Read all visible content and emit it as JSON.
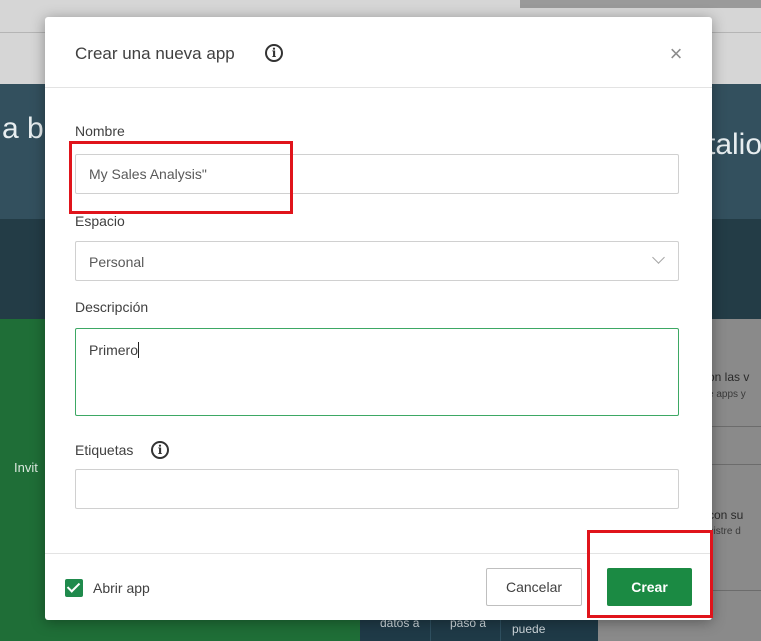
{
  "background": {
    "hero_left": "a b",
    "hero_right": "talio",
    "invite": "Invit",
    "card1_title": "on las v",
    "card1_sub": "e apps y",
    "card2_title": "con su",
    "card2_sub": "nistre d",
    "table_cells": [
      "datos a",
      "paso a",
      "puede"
    ]
  },
  "dialog": {
    "title": "Crear una nueva app",
    "close_glyph": "×",
    "name": {
      "label": "Nombre",
      "value": "My Sales Analysis\""
    },
    "space": {
      "label": "Espacio",
      "value": "Personal"
    },
    "description": {
      "label": "Descripción",
      "value": "Primero"
    },
    "tags": {
      "label": "Etiquetas",
      "value": ""
    },
    "footer": {
      "open_app_label": "Abrir app",
      "open_app_checked": true,
      "cancel_label": "Cancelar",
      "create_label": "Crear"
    }
  },
  "colors": {
    "primary": "#1b8a43",
    "focus_border": "#3da864",
    "highlight": "#e0141b"
  },
  "icons": {
    "title_info": "info-icon",
    "tags_info": "info-icon",
    "close": "close-icon",
    "dropdown": "chevron-down-icon",
    "checkbox": "check-icon"
  }
}
